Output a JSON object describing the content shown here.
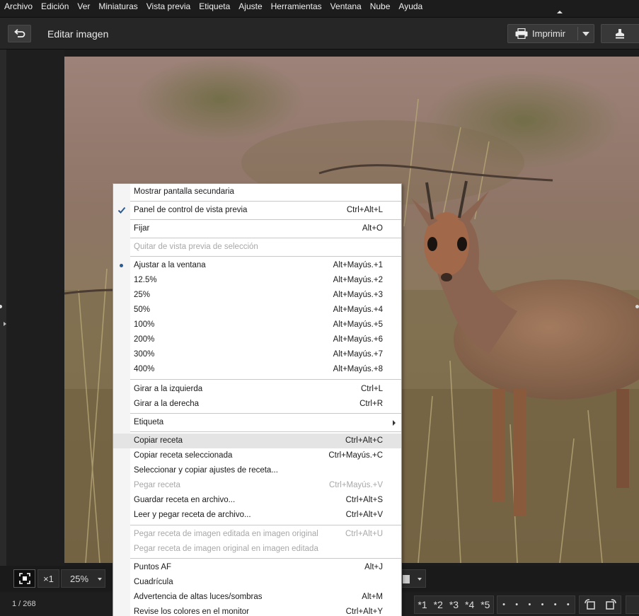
{
  "menubar": {
    "items": [
      "Archivo",
      "Edición",
      "Ver",
      "Miniaturas",
      "Vista previa",
      "Etiqueta",
      "Ajuste",
      "Herramientas",
      "Ventana",
      "Nube",
      "Ayuda"
    ]
  },
  "toolbar": {
    "title": "Editar imagen",
    "print_label": "Imprimir"
  },
  "bottom": {
    "x1_label": "×1",
    "zoom_value": "25%",
    "counter": "1 / 268",
    "ratings": [
      "*1",
      "*2",
      "*3",
      "*4",
      "*5"
    ],
    "dots": [
      "•",
      "•",
      "•",
      "•",
      "•",
      "•"
    ]
  },
  "context_menu": {
    "items": [
      {
        "label": "Mostrar pantalla secundaria",
        "shortcut": "",
        "disabled": false
      },
      {
        "label": "Panel de control de vista previa",
        "shortcut": "Ctrl+Alt+L",
        "checked": true
      },
      {
        "label": "Fijar",
        "shortcut": "Alt+O"
      },
      {
        "label": "Quitar de vista previa de selección",
        "shortcut": "",
        "disabled": true
      },
      {
        "label": "Ajustar a la ventana",
        "shortcut": "Alt+Mayús.+1",
        "selected": true
      },
      {
        "label": "12.5%",
        "shortcut": "Alt+Mayús.+2"
      },
      {
        "label": "25%",
        "shortcut": "Alt+Mayús.+3"
      },
      {
        "label": "50%",
        "shortcut": "Alt+Mayús.+4"
      },
      {
        "label": "100%",
        "shortcut": "Alt+Mayús.+5"
      },
      {
        "label": "200%",
        "shortcut": "Alt+Mayús.+6"
      },
      {
        "label": "300%",
        "shortcut": "Alt+Mayús.+7"
      },
      {
        "label": "400%",
        "shortcut": "Alt+Mayús.+8"
      },
      {
        "label": "Girar a la izquierda",
        "shortcut": "Ctrl+L"
      },
      {
        "label": "Girar a la derecha",
        "shortcut": "Ctrl+R"
      },
      {
        "label": "Etiqueta",
        "shortcut": "",
        "submenu": true
      },
      {
        "label": "Copiar receta",
        "shortcut": "Ctrl+Alt+C",
        "highlighted": true
      },
      {
        "label": "Copiar receta seleccionada",
        "shortcut": "Ctrl+Mayús.+C"
      },
      {
        "label": "Seleccionar y copiar ajustes de receta...",
        "shortcut": ""
      },
      {
        "label": "Pegar receta",
        "shortcut": "Ctrl+Mayús.+V",
        "disabled": true
      },
      {
        "label": "Guardar receta en archivo...",
        "shortcut": "Ctrl+Alt+S"
      },
      {
        "label": "Leer y pegar receta de archivo...",
        "shortcut": "Ctrl+Alt+V"
      },
      {
        "label": "Pegar receta de imagen editada en imagen original",
        "shortcut": "Ctrl+Alt+U",
        "disabled": true
      },
      {
        "label": "Pegar receta de imagen original en imagen editada",
        "shortcut": "",
        "disabled": true
      },
      {
        "label": "Puntos AF",
        "shortcut": "Alt+J"
      },
      {
        "label": "Cuadrícula",
        "shortcut": ""
      },
      {
        "label": "Advertencia de altas luces/sombras",
        "shortcut": "Alt+M"
      },
      {
        "label": "Revise los colores en el monitor",
        "shortcut": "Ctrl+Alt+Y"
      }
    ]
  },
  "colors": {
    "check_blue": "#2a5c93",
    "menu_bg": "#ffffff",
    "app_bg": "#1c1c1c"
  }
}
